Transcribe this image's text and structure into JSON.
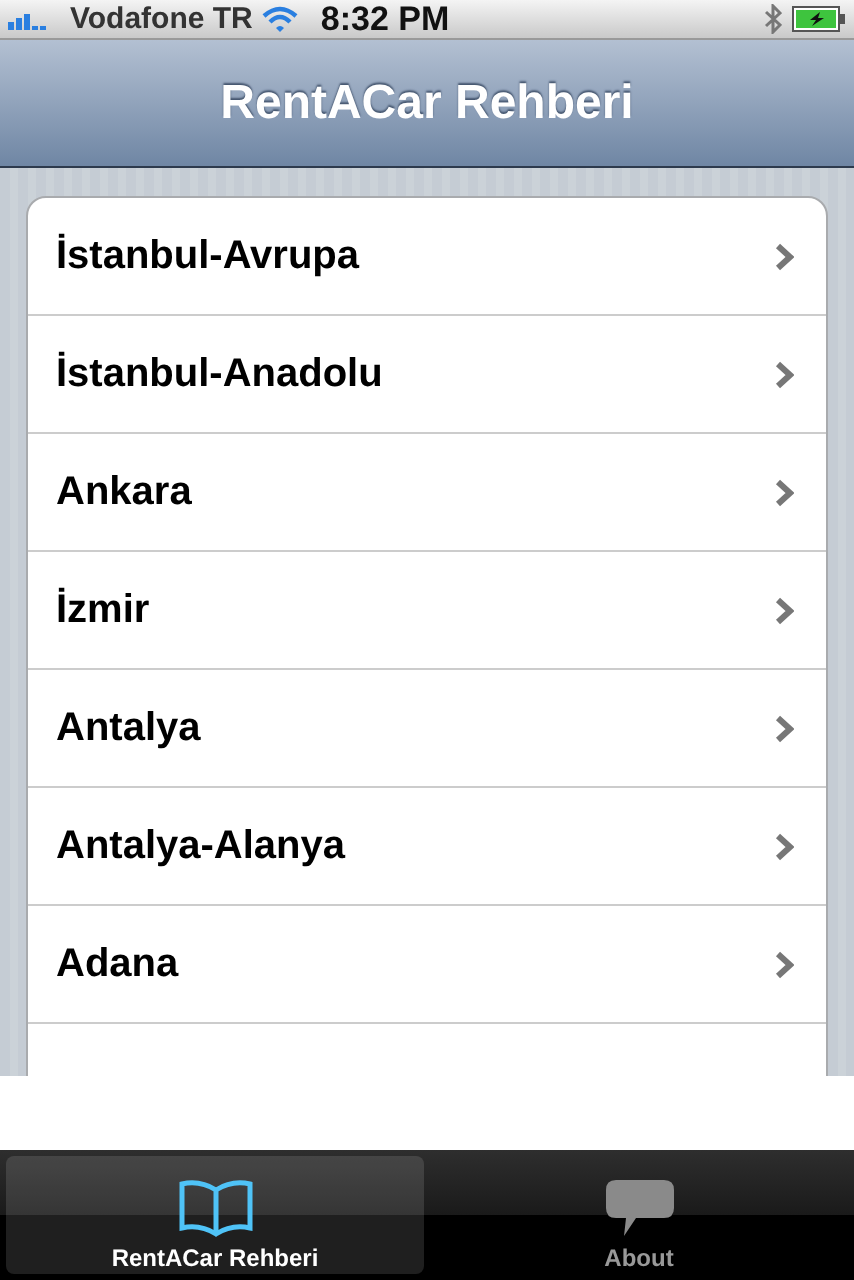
{
  "status_bar": {
    "carrier": "Vodafone TR",
    "time": "8:32 PM"
  },
  "nav_bar": {
    "title": "RentACar Rehberi"
  },
  "list": {
    "items": [
      {
        "label": "İstanbul-Avrupa"
      },
      {
        "label": "İstanbul-Anadolu"
      },
      {
        "label": "Ankara"
      },
      {
        "label": "İzmir"
      },
      {
        "label": "Antalya"
      },
      {
        "label": "Antalya-Alanya"
      },
      {
        "label": "Adana"
      }
    ]
  },
  "tab_bar": {
    "tabs": [
      {
        "label": "RentACar Rehberi",
        "kind": "book",
        "selected": true
      },
      {
        "label": "About",
        "kind": "chat",
        "selected": false
      }
    ]
  }
}
